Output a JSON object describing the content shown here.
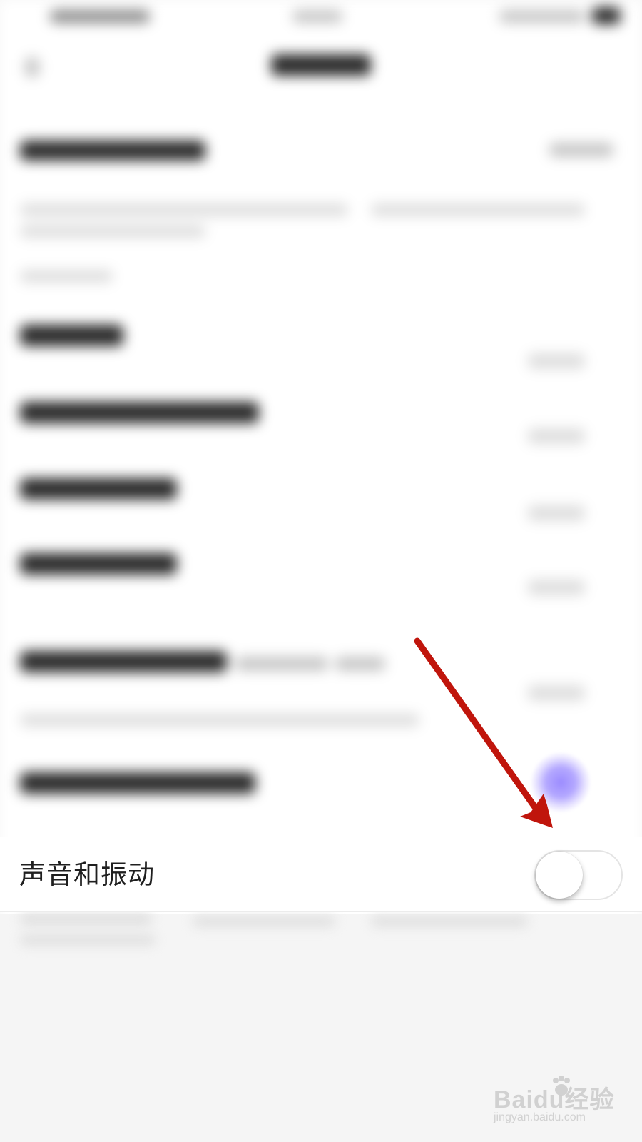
{
  "settings_row": {
    "label": "声音和振动",
    "toggle_on": false
  },
  "colors": {
    "arrow": "#c0150c",
    "highlight_dot": "#9c8cff",
    "toggle_track_off": "#ffffff"
  },
  "watermark": {
    "brand": "Baidu经验",
    "url": "jingyan.baidu.com"
  }
}
